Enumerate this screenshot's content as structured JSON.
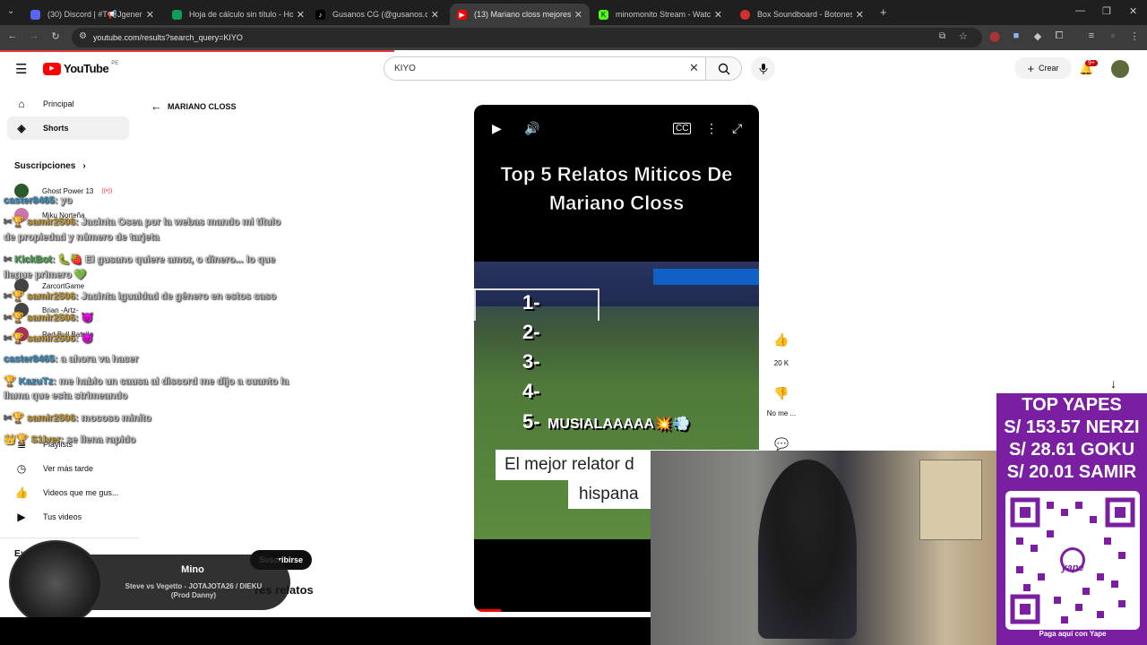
{
  "browser": {
    "tabs": [
      {
        "title": "(30) Discord | #T📢Jgeneral",
        "favicon_color": "#5865f2",
        "active": false
      },
      {
        "title": "Hoja de cálculo sin título - Hoja",
        "favicon_color": "#0f9d58",
        "active": false
      },
      {
        "title": "Gusanos CG (@gusanos.cg) | Ti",
        "favicon_color": "#000000",
        "active": false
      },
      {
        "title": "(13) Mariano closs mejores rela",
        "favicon_color": "#ff0000",
        "active": true
      },
      {
        "title": "minomonito Stream - Watch Li",
        "favicon_color": "#53fc18",
        "active": false
      },
      {
        "title": "Box Soundboard - Botones de",
        "favicon_color": "#d32f2f",
        "active": false
      }
    ],
    "new_tab": "+",
    "url": "youtube.com/results?search_query=KIYO"
  },
  "youtube": {
    "logo_text": "YouTube",
    "region": "PE",
    "search_value": "KIYO",
    "create_label": "Crear",
    "notif_badge": "9+",
    "sidebar": {
      "items": [
        {
          "label": "Principal",
          "icon": "home-icon"
        },
        {
          "label": "Shorts",
          "icon": "shorts-icon"
        }
      ],
      "subs_title": "Suscripciones",
      "subs": [
        "Ghost Power 13",
        "Miku Norteña",
        "ZarcortGame",
        "Brian -Artz-",
        "Red Bull Batalla"
      ],
      "you_items": [
        {
          "label": "Playlists",
          "icon": "playlist-icon"
        },
        {
          "label": "Ver más tarde",
          "icon": "clock-icon"
        },
        {
          "label": "Videos que me gus...",
          "icon": "like-icon"
        },
        {
          "label": "Tus videos",
          "icon": "video-icon"
        }
      ],
      "explore_label": "Expl"
    },
    "back_label": "MARIANO CLOSS",
    "video": {
      "title_line1": "Top 5 Relatos Miticos De",
      "title_line2": "Mariano Closs",
      "numbers": [
        "1-",
        "2-",
        "3-",
        "4-",
        "5-"
      ],
      "fifth": "MUSIALAAAAA💥💨",
      "caption1": "El mejor relator d",
      "caption2": "hispana"
    },
    "actions": {
      "likes": "20 K",
      "dislike_label": "No me ..."
    },
    "bottom_text": "res relatos",
    "subscribe_label": "Suscribirse"
  },
  "chat": [
    {
      "user": "caster8465",
      "msg": "yo",
      "color": "u3"
    },
    {
      "user": "samir2506",
      "msg": "Jacinta Osea por la webas mando mi título",
      "color": "u2"
    },
    {
      "user": "",
      "msg": "de propiedad y número de tarjeta",
      "color": ""
    },
    {
      "user": "KickBot",
      "msg": "🐛🍓 El gusano quiere amor, o dinero... lo que",
      "color": "u"
    },
    {
      "user": "",
      "msg": "llegue primero 💚",
      "color": ""
    },
    {
      "user": "samir2506",
      "msg": "Jacinta igualdad de género en estos caso",
      "color": "u2"
    },
    {
      "user": "samir2506",
      "msg": "",
      "color": "u2"
    },
    {
      "user": "samir2506",
      "msg": "",
      "color": "u2"
    },
    {
      "user": "caster8465",
      "msg": "a ahora va hacer",
      "color": "u3"
    },
    {
      "user": "KazuTz",
      "msg": "me hablo un causa al discord me dijo a cuanto la",
      "color": "u3"
    },
    {
      "user": "",
      "msg": "llama que esta strimeando",
      "color": ""
    },
    {
      "user": "samir2506",
      "msg": "mocoso minito",
      "color": "u2"
    },
    {
      "user": "S1lver",
      "msg": "se llena rapido",
      "color": "u2"
    }
  ],
  "yape": {
    "title": "TOP YAPES",
    "entries": [
      "S/ 153.57 NERZI",
      "S/ 28.61 GOKU",
      "S/ 20.01 SAMIR"
    ],
    "footer": "Paga aquí con Yape",
    "brand": "yape"
  },
  "now_playing": {
    "name": "Mino",
    "song": "Steve vs Vegetto - JOTAJOTA26 / DIEKU (Prod Danny)"
  }
}
